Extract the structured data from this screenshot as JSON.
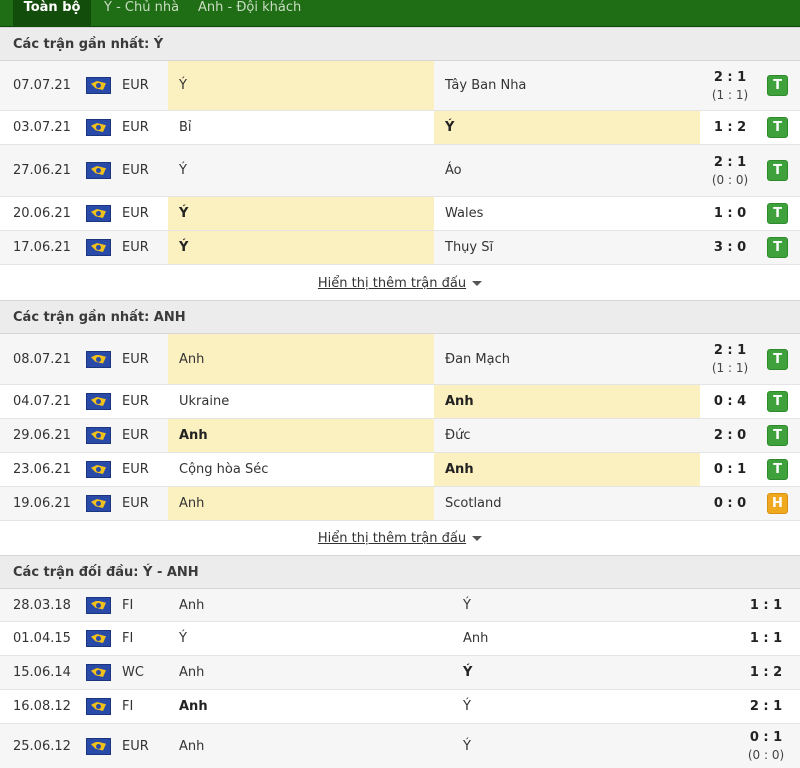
{
  "tabs": [
    {
      "label": "Toàn bộ",
      "active": true
    },
    {
      "label": "Ý - Chủ nhà",
      "active": false
    },
    {
      "label": "Anh - Đội khách",
      "active": false
    }
  ],
  "sections": [
    {
      "title": "Các trận gần nhất: Ý",
      "more_label": "Hiển thị thêm trận đấu",
      "rows": [
        {
          "date": "07.07.21",
          "league": "EUR",
          "home": "Ý",
          "away": "Tây Ban Nha",
          "score": "2 : 1",
          "ht": "(1 : 1)",
          "result": "T"
        },
        {
          "date": "03.07.21",
          "league": "EUR",
          "home": "Bỉ",
          "away": "Ý",
          "score": "1 : 2",
          "ht": "",
          "result": "T"
        },
        {
          "date": "27.06.21",
          "league": "EUR",
          "home": "Ý",
          "away": "Áo",
          "score": "2 : 1",
          "ht": "(0 : 0)",
          "result": "T"
        },
        {
          "date": "20.06.21",
          "league": "EUR",
          "home": "Ý",
          "away": "Wales",
          "score": "1 : 0",
          "ht": "",
          "result": "T"
        },
        {
          "date": "17.06.21",
          "league": "EUR",
          "home": "Ý",
          "away": "Thụy Sĩ",
          "score": "3 : 0",
          "ht": "",
          "result": "T"
        }
      ]
    },
    {
      "title": "Các trận gần nhất: ANH",
      "more_label": "Hiển thị thêm trận đấu",
      "rows": [
        {
          "date": "08.07.21",
          "league": "EUR",
          "home": "Anh",
          "away": "Đan Mạch",
          "score": "2 : 1",
          "ht": "(1 : 1)",
          "result": "T"
        },
        {
          "date": "04.07.21",
          "league": "EUR",
          "home": "Ukraine",
          "away": "Anh",
          "score": "0 : 4",
          "ht": "",
          "result": "T"
        },
        {
          "date": "29.06.21",
          "league": "EUR",
          "home": "Anh",
          "away": "Đức",
          "score": "2 : 0",
          "ht": "",
          "result": "T"
        },
        {
          "date": "23.06.21",
          "league": "EUR",
          "home": "Cộng hòa Séc",
          "away": "Anh",
          "score": "0 : 1",
          "ht": "",
          "result": "T"
        },
        {
          "date": "19.06.21",
          "league": "EUR",
          "home": "Anh",
          "away": "Scotland",
          "score": "0 : 0",
          "ht": "",
          "result": "H"
        }
      ]
    },
    {
      "title": "Các trận đối đầu: Ý - ANH",
      "rows": [
        {
          "date": "28.03.18",
          "league": "FI",
          "home": "Anh",
          "away": "Ý",
          "score": "1 : 1",
          "ht": ""
        },
        {
          "date": "01.04.15",
          "league": "FI",
          "home": "Ý",
          "away": "Anh",
          "score": "1 : 1",
          "ht": ""
        },
        {
          "date": "15.06.14",
          "league": "WC",
          "home": "Anh",
          "away": "Ý",
          "score": "1 : 2",
          "ht": ""
        },
        {
          "date": "16.08.12",
          "league": "FI",
          "home": "Anh",
          "away": "Ý",
          "score": "2 : 1",
          "ht": ""
        },
        {
          "date": "25.06.12",
          "league": "EUR",
          "home": "Anh",
          "away": "Ý",
          "score": "0 : 1",
          "ht": "(0 : 0)"
        }
      ]
    }
  ],
  "colors": {
    "win": "#3fa13b",
    "draw": "#f0a91e",
    "highlight": "#fbf1c0",
    "tabbar": "#1f6d14"
  }
}
